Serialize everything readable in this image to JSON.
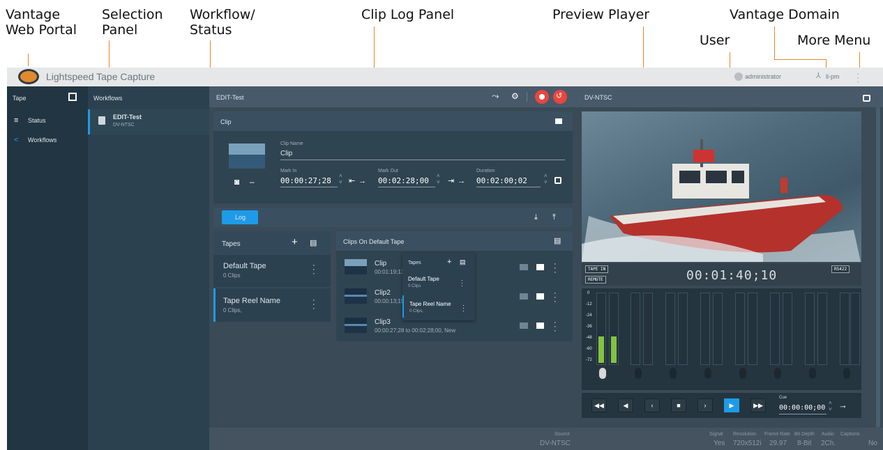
{
  "callouts": {
    "portal": "Vantage\nWeb Portal",
    "selection": "Selection\nPanel",
    "workflow": "Workflow/\nStatus",
    "cliplog": "Clip Log Panel",
    "preview": "Preview Player",
    "domain": "Vantage Domain",
    "user": "User",
    "more": "More Menu"
  },
  "app": {
    "title": "Lightspeed Tape Capture",
    "user": "administrator",
    "domain": "ll-pm"
  },
  "sidebar": {
    "header": "Tape",
    "items": [
      {
        "label": "Status"
      },
      {
        "label": "Workflows"
      }
    ]
  },
  "selection": {
    "header": "Workflows",
    "item": {
      "name": "EDIT-Test",
      "format": "DV-NTSC"
    }
  },
  "cliplog": {
    "header": "EDIT-Test",
    "clip_section": "Clip",
    "clip_name_label": "Clip Name",
    "clip_name": "Clip",
    "mark_in_label": "Mark In",
    "mark_in": "00:00:27;28",
    "mark_out_label": "Mark Out",
    "mark_out": "00:02:28;00",
    "duration_label": "Duration",
    "duration": "00:02:00;02",
    "log_button": "Log"
  },
  "tapes": {
    "header": "Tapes",
    "items": [
      {
        "name": "Default Tape",
        "count": "0 Clips"
      },
      {
        "name": "Tape Reel Name",
        "count": "0 Clips,"
      }
    ]
  },
  "clips": {
    "header": "Clips On Default Tape",
    "items": [
      {
        "name": "Clip",
        "info": "00:01:19;13"
      },
      {
        "name": "Clip2",
        "info": "00:00:13;15"
      },
      {
        "name": "Clip3",
        "info": "00:00:27;28 to 00:02:28;00, New"
      }
    ]
  },
  "popup": {
    "header": "Tapes",
    "items": [
      {
        "name": "Default Tape",
        "count": "0 Clips"
      },
      {
        "name": "Tape Reel Name",
        "count": "0 Clips,"
      }
    ]
  },
  "status_bar": {
    "source_label": "Source",
    "source_value": "DV-NTSC"
  },
  "player": {
    "header": "DV-NTSC",
    "timecode": "00:01:40;10",
    "tape_in": "TAPE IN",
    "remote": "REMOTE",
    "rs422": "RS422",
    "vu_labels": [
      "0",
      "-12",
      "-24",
      "-36",
      "-48",
      "-60",
      "-72"
    ],
    "cue_label": "Cue",
    "cue_value": "00:00:00;00"
  },
  "signal": {
    "headers": [
      "Signal",
      "Resolution",
      "Frame Rate",
      "Bit Depth",
      "Audio",
      "Captions"
    ],
    "values": [
      "Yes",
      "720x512i",
      "29.97",
      "8-Bit",
      "2Ch.",
      "No"
    ]
  },
  "colors": {
    "accent": "#1e9be8",
    "record": "#e8463f",
    "lead": "#e8842a"
  }
}
